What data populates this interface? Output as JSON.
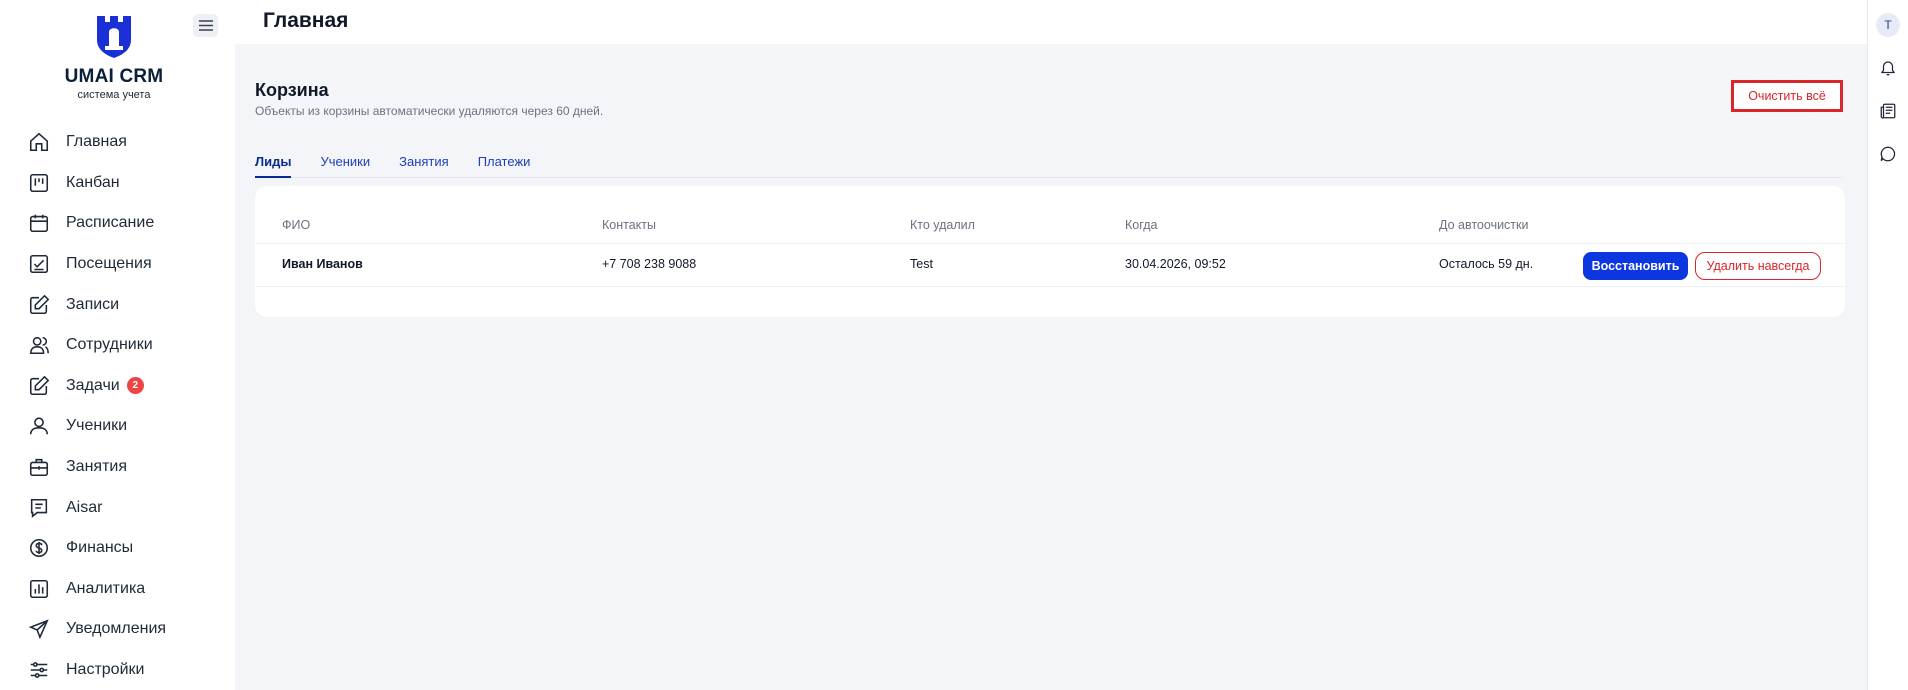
{
  "app": {
    "brand": "UMAI CRM",
    "brand_sub": "система учета",
    "page_title": "Главная"
  },
  "sidebar": {
    "items": [
      {
        "label": "Главная",
        "icon": "home-icon"
      },
      {
        "label": "Канбан",
        "icon": "kanban-icon"
      },
      {
        "label": "Расписание",
        "icon": "calendar-icon"
      },
      {
        "label": "Посещения",
        "icon": "attendance-icon"
      },
      {
        "label": "Записи",
        "icon": "edit-icon"
      },
      {
        "label": "Сотрудники",
        "icon": "staff-icon"
      },
      {
        "label": "Задачи",
        "icon": "tasks-icon",
        "badge": "2"
      },
      {
        "label": "Ученики",
        "icon": "user-icon"
      },
      {
        "label": "Занятия",
        "icon": "briefcase-icon"
      },
      {
        "label": "Aisar",
        "icon": "chat-doc-icon"
      },
      {
        "label": "Финансы",
        "icon": "dollar-icon"
      },
      {
        "label": "Аналитика",
        "icon": "chart-icon"
      },
      {
        "label": "Уведомления",
        "icon": "send-icon"
      },
      {
        "label": "Настройки",
        "icon": "sliders-icon"
      }
    ]
  },
  "trash": {
    "title": "Корзина",
    "subtitle": "Объекты из корзины автоматически удаляются через 60 дней.",
    "clear_all_label": "Очистить всё",
    "tabs": [
      "Лиды",
      "Ученики",
      "Занятия",
      "Платежи"
    ],
    "active_tab": "Лиды",
    "columns": [
      "ФИО",
      "Контакты",
      "Кто удалил",
      "Когда",
      "До автоочистки"
    ],
    "rows": [
      {
        "name": "Иван Иванов",
        "contact": "+7 708 238 9088",
        "deleted_by": "Test",
        "when": "30.04.2026, 09:52",
        "remaining": "Осталось 59 дн.",
        "restore_label": "Восстановить",
        "delete_label": "Удалить навсегда"
      }
    ]
  },
  "rail": {
    "avatar_initial": "T"
  },
  "colors": {
    "accent": "#0b36e0",
    "danger": "#d9262a",
    "badge": "#ef4444",
    "background": "#f4f5f8"
  }
}
